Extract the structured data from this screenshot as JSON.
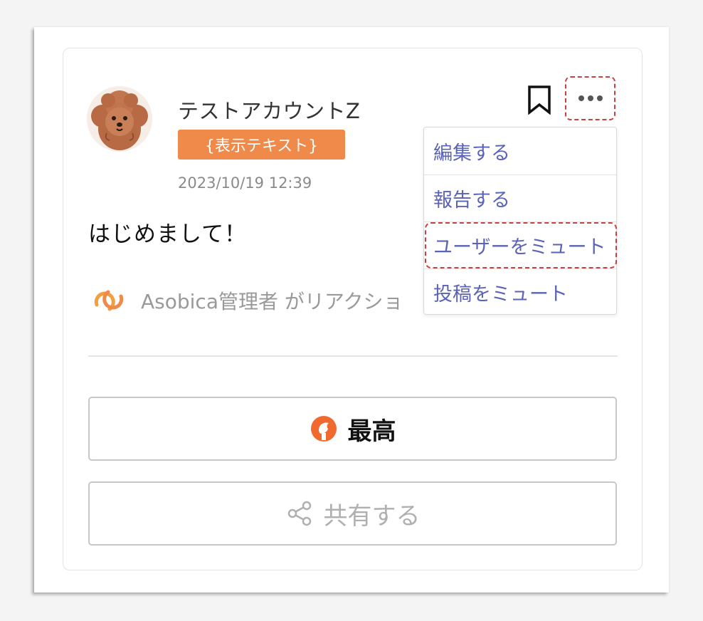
{
  "post": {
    "username": "テストアカウントZ",
    "badge": "{表示テキスト}",
    "timestamp": "2023/10/19 12:39",
    "body": "はじめまして！",
    "reaction_summary": "Asobica管理者 がリアクショ"
  },
  "menu": {
    "items": [
      {
        "label": "編集する"
      },
      {
        "label": "報告する"
      },
      {
        "label": "ユーザーをミュート"
      },
      {
        "label": "投稿をミュート"
      }
    ]
  },
  "actions": {
    "react_label": "最高",
    "share_label": "共有する"
  },
  "icons": {
    "bookmark": "bookmark-icon",
    "more": "more-dots-icon",
    "reaction": "reaction-logo-icon",
    "react": "react-badge-icon",
    "share": "share-icon"
  },
  "colors": {
    "badge": "#ef8a4a",
    "menu_text": "#5b63b6",
    "highlight": "#c94040",
    "reaction_logo": "#f2a03d"
  }
}
